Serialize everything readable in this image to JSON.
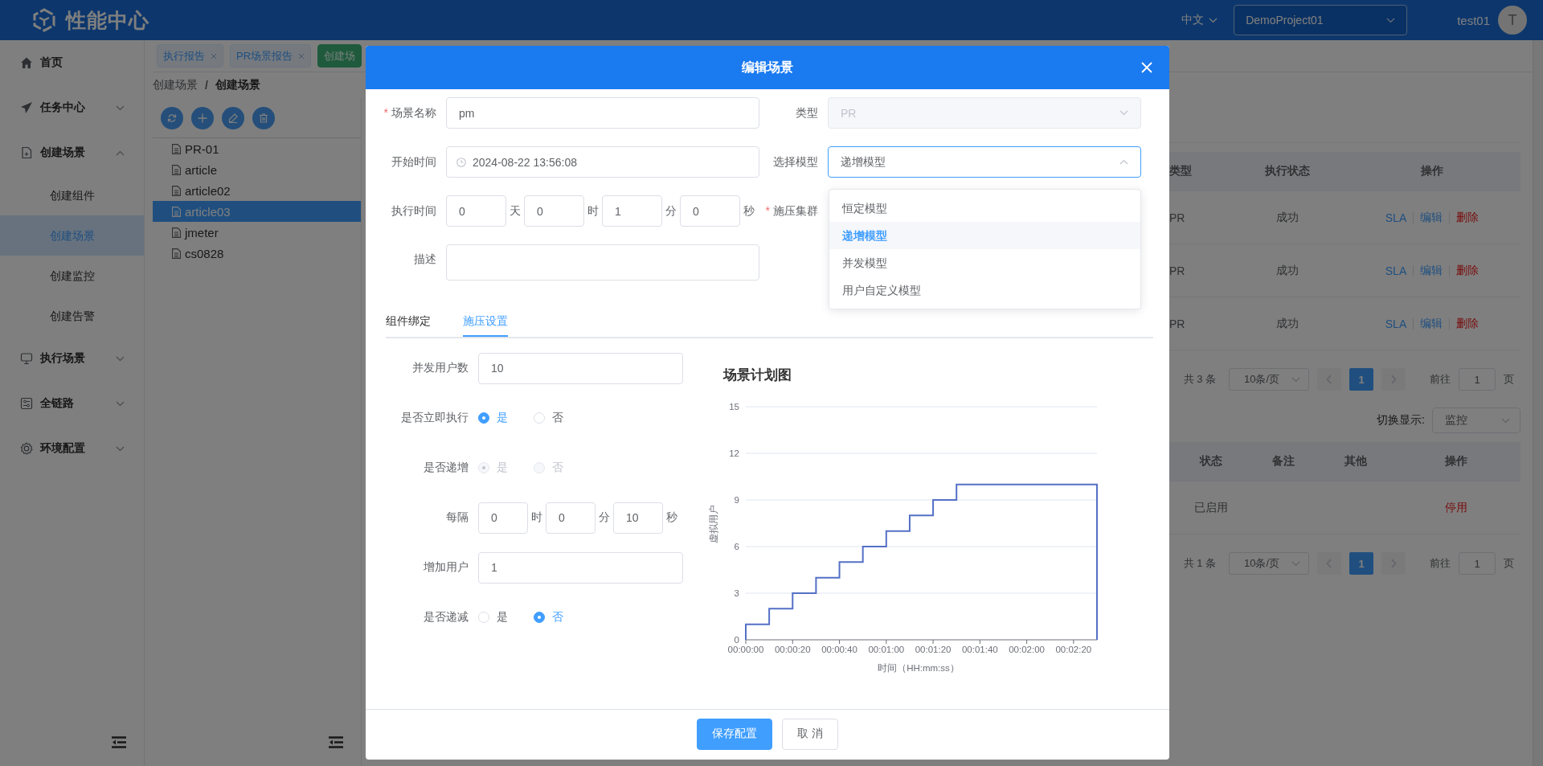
{
  "header": {
    "title": "性能中心",
    "language": "中文",
    "project": "DemoProject01",
    "user": "test01",
    "avatar": "T"
  },
  "sidebar": {
    "items": [
      {
        "label": "首页"
      },
      {
        "label": "任务中心",
        "expanded": false
      },
      {
        "label": "创建场景",
        "expanded": true,
        "children": [
          {
            "label": "创建组件",
            "selected": false
          },
          {
            "label": "创建场景",
            "selected": true
          },
          {
            "label": "创建监控",
            "selected": false
          },
          {
            "label": "创建告警",
            "selected": false
          }
        ]
      },
      {
        "label": "执行场景",
        "expanded": false
      },
      {
        "label": "全链路",
        "expanded": false
      },
      {
        "label": "环境配置",
        "expanded": false
      }
    ]
  },
  "tags": [
    {
      "label": "执行报告",
      "selected": false,
      "closable": true
    },
    {
      "label": "PR场景报告",
      "selected": false,
      "closable": true
    },
    {
      "label": "创建场",
      "selected": true,
      "closable": false
    }
  ],
  "breadcrumb": {
    "items": [
      "创建场景",
      "创建场景"
    ],
    "separator": "/"
  },
  "tree": {
    "items": [
      {
        "label": "PR-01",
        "selected": false
      },
      {
        "label": "article",
        "selected": false
      },
      {
        "label": "article02",
        "selected": false
      },
      {
        "label": "article03",
        "selected": true
      },
      {
        "label": "jmeter",
        "selected": false
      },
      {
        "label": "cs0828",
        "selected": false
      }
    ]
  },
  "scenario_table": {
    "columns": [
      "类型",
      "执行状态",
      "操作"
    ],
    "rows": [
      {
        "type": "PR",
        "status": "成功",
        "actions": [
          {
            "label": "SLA",
            "kind": "link"
          },
          {
            "label": "编辑",
            "kind": "link"
          },
          {
            "label": "删除",
            "kind": "danger"
          }
        ]
      },
      {
        "type": "PR",
        "status": "成功",
        "actions": [
          {
            "label": "SLA",
            "kind": "link"
          },
          {
            "label": "编辑",
            "kind": "link"
          },
          {
            "label": "删除",
            "kind": "danger"
          }
        ]
      },
      {
        "type": "PR",
        "status": "成功",
        "actions": [
          {
            "label": "SLA",
            "kind": "link"
          },
          {
            "label": "编辑",
            "kind": "link"
          },
          {
            "label": "删除",
            "kind": "danger"
          }
        ]
      }
    ]
  },
  "scenario_pagination": {
    "total": "共 3 条",
    "page_size": "10条/页",
    "pages": [
      {
        "label": "1",
        "selected": true
      }
    ],
    "goto_label": "前往",
    "goto_value": "1",
    "goto_suffix": "页"
  },
  "display_switch": {
    "label": "切换显示:",
    "value": "监控"
  },
  "monitor_table": {
    "columns": [
      "状态",
      "备注",
      "其他",
      "操作"
    ],
    "rows": [
      {
        "status": "已启用",
        "action": "停用"
      }
    ]
  },
  "monitor_pagination": {
    "total": "共 1 条",
    "page_size": "10条/页",
    "pages": [
      {
        "label": "1",
        "selected": true
      }
    ],
    "goto_label": "前往",
    "goto_value": "1",
    "goto_suffix": "页"
  },
  "dialog": {
    "title": "编辑场景",
    "required_mark": "*",
    "name": {
      "label": "场景名称",
      "required": true,
      "value": "pm"
    },
    "type": {
      "label": "类型",
      "value": "PR",
      "disabled": true
    },
    "start_time": {
      "label": "开始时间",
      "value": "2024-08-22 13:56:08"
    },
    "model": {
      "label": "选择模型",
      "value": "递增模型",
      "expanded": true,
      "options": [
        {
          "label": "恒定模型",
          "selected": false
        },
        {
          "label": "递增模型",
          "selected": true
        },
        {
          "label": "并发模型",
          "selected": false
        },
        {
          "label": "用户自定义模型",
          "selected": false
        }
      ]
    },
    "duration": {
      "label": "执行时间",
      "parts": [
        {
          "value": "0",
          "unit": "天"
        },
        {
          "value": "0",
          "unit": "时"
        },
        {
          "value": "1",
          "unit": "分"
        },
        {
          "value": "0",
          "unit": "秒"
        }
      ]
    },
    "cluster": {
      "label": "施压集群",
      "required": true
    },
    "description": {
      "label": "描述"
    },
    "tabs": [
      {
        "label": "组件绑定",
        "selected": false
      },
      {
        "label": "施压设置",
        "selected": true
      }
    ],
    "load_settings": [
      {
        "kind": "input",
        "label": "并发用户数",
        "value": "10"
      },
      {
        "kind": "radio",
        "label": "是否立即执行",
        "disabled": false,
        "options": [
          {
            "label": "是",
            "selected": true
          },
          {
            "label": "否",
            "selected": false
          }
        ]
      },
      {
        "kind": "radio",
        "label": "是否递增",
        "disabled": true,
        "options": [
          {
            "label": "是",
            "selected": true
          },
          {
            "label": "否",
            "selected": false
          }
        ]
      },
      {
        "kind": "interval",
        "label": "每隔",
        "parts": [
          {
            "value": "0",
            "unit": "时"
          },
          {
            "value": "0",
            "unit": "分"
          },
          {
            "value": "10",
            "unit": "秒"
          }
        ]
      },
      {
        "kind": "input",
        "label": "增加用户",
        "value": "1"
      },
      {
        "kind": "radio",
        "label": "是否递减",
        "disabled": false,
        "options": [
          {
            "label": "是",
            "selected": false
          },
          {
            "label": "否",
            "selected": true
          }
        ]
      }
    ],
    "chart": {
      "chart_data": {
        "type": "line",
        "title": "场景计划图",
        "xlabel": "时间（HH:mm:ss）",
        "ylabel": "虚拟用户",
        "x": [
          0,
          0,
          10,
          10,
          20,
          20,
          30,
          30,
          40,
          40,
          50,
          50,
          60,
          60,
          70,
          70,
          80,
          80,
          90,
          90,
          150,
          150
        ],
        "series": [
          {
            "color": "#5470c6",
            "values": [
              0,
              1,
              1,
              2,
              2,
              3,
              3,
              4,
              4,
              5,
              5,
              6,
              6,
              7,
              7,
              8,
              8,
              9,
              9,
              10,
              10,
              0
            ]
          }
        ],
        "grid": true,
        "xlim": [
          0,
          150
        ],
        "ylim": [
          0,
          15
        ],
        "xticks": [
          {
            "value": 0,
            "label": "00:00:00"
          },
          {
            "value": 20,
            "label": "00:00:20"
          },
          {
            "value": 40,
            "label": "00:00:40"
          },
          {
            "value": 60,
            "label": "00:01:00"
          },
          {
            "value": 80,
            "label": "00:01:20"
          },
          {
            "value": 100,
            "label": "00:01:40"
          },
          {
            "value": 120,
            "label": "00:02:00"
          },
          {
            "value": 140,
            "label": "00:02:20"
          }
        ],
        "yticks": [
          0,
          3,
          6,
          9,
          12,
          15
        ]
      }
    },
    "buttons": [
      {
        "label": "保存配置",
        "kind": "primary"
      },
      {
        "label": "取 消",
        "kind": "default"
      }
    ]
  }
}
